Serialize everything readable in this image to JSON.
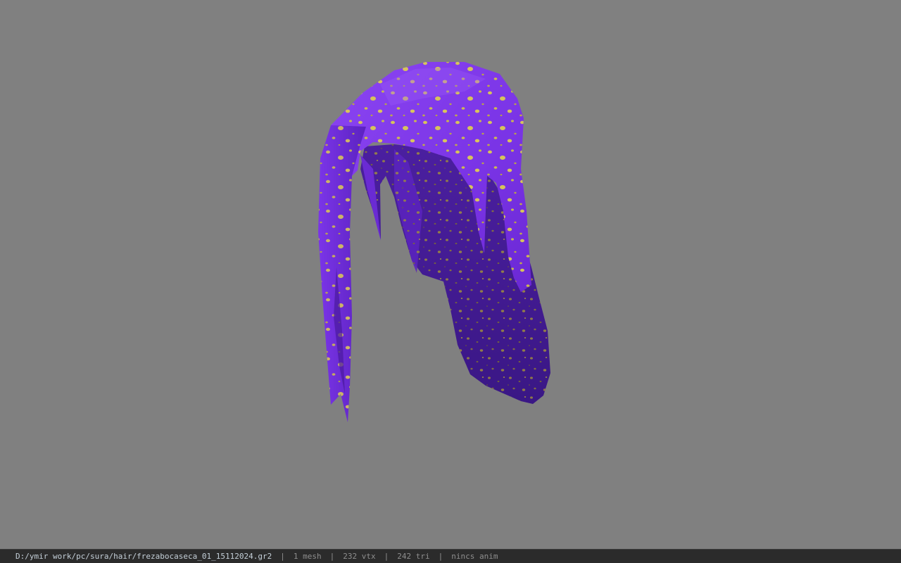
{
  "viewer": {
    "background_color": "#808080",
    "model": {
      "description_icon": "hair-mesh",
      "base_color": "#7a35e6",
      "shadow_color": "#3d1c86",
      "speckle_color": "#d9c25a"
    }
  },
  "status": {
    "file_path": "D:/ymir work/pc/sura/hair/frezabocaseca_01_15112024.gr2",
    "separator": "|",
    "mesh_count": "1 mesh",
    "vertex_count": "232 vtx",
    "triangle_count": "242 tri",
    "anim_state": "nincs anim"
  }
}
